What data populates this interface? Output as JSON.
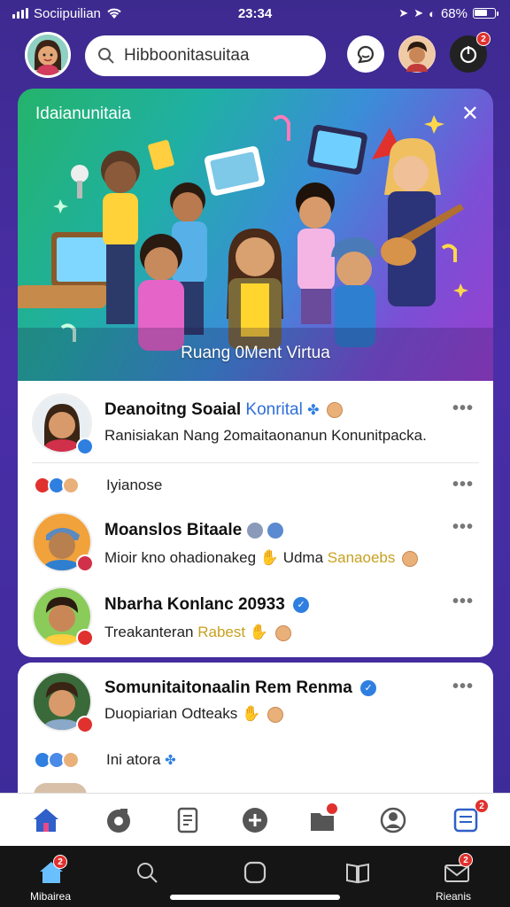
{
  "status": {
    "carrier": "Sociipuilian",
    "time": "23:34",
    "battery": "68%"
  },
  "search": {
    "placeholder": "Hibboonitasuitaa"
  },
  "notifications": {
    "badge": "2"
  },
  "banner": {
    "title": "Idaianunitaia",
    "caption": "Ruang 0Ment Virtua"
  },
  "feed": {
    "items": [
      {
        "title": "Deanoitng Soaial",
        "title_accent": "Konrital",
        "subtitle": "Ranisiakan Nang 2omaitaonanun Konunitpacka."
      },
      {
        "reaction_text": "Iyianose"
      },
      {
        "title": "Moanslos Bitaale",
        "subtitle": "Mioir kno ohadionakeg",
        "subtitle_tail": "Udma",
        "subtitle_accent": "Sanaoebs"
      },
      {
        "title": "Nbarha Konlanc 20933",
        "subtitle": "Treakanteran",
        "subtitle_accent": "Rabest"
      }
    ],
    "second": {
      "title": "Somunitaitonaalin Rem Renma",
      "subtitle": "Duopiarian Odteaks",
      "reaction_text": "Ini atora"
    }
  },
  "bottom_nav": {
    "badge_folder": "",
    "badge_notes": "2"
  },
  "dock": {
    "left_label": "Mibairea",
    "right_label": "Rieanis",
    "left_badge": "2",
    "right_badge": "2"
  },
  "colors": {
    "accent_blue": "#2f7fe0",
    "badge_red": "#e0312e",
    "gold_text": "#c8a021"
  }
}
